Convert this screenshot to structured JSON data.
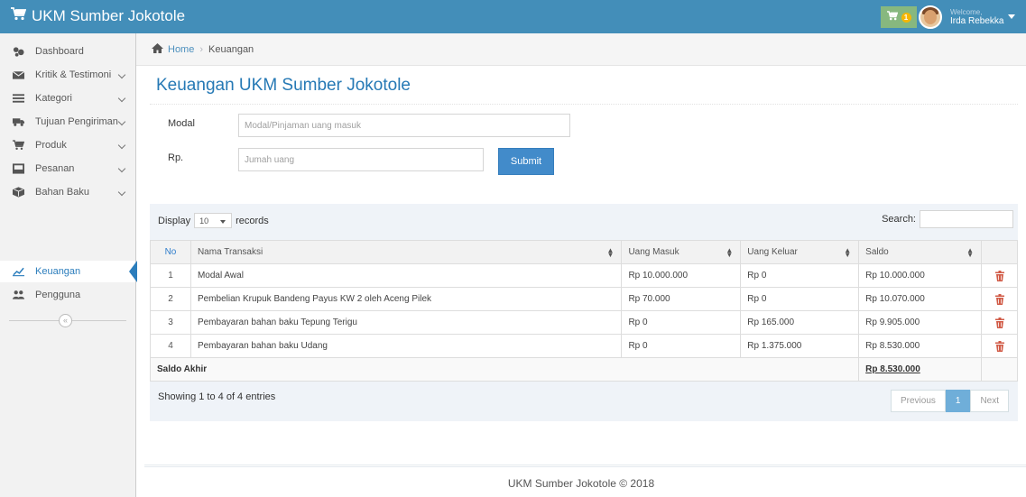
{
  "app": {
    "title": "UKM Sumber Jokotole",
    "cart_count": "1"
  },
  "user": {
    "welcome": "Welcome,",
    "name": "Irda Rebekka"
  },
  "sidebar": {
    "items": [
      {
        "label": "Dashboard",
        "icon": "tachometer-icon"
      },
      {
        "label": "Kritik & Testimoni",
        "icon": "envelope-icon"
      },
      {
        "label": "Kategori",
        "icon": "list-icon"
      },
      {
        "label": "Tujuan Pengiriman",
        "icon": "truck-icon"
      },
      {
        "label": "Produk",
        "icon": "shopping-cart-icon"
      },
      {
        "label": "Pesanan",
        "icon": "inbox-icon"
      },
      {
        "label": "Bahan Baku",
        "icon": "cube-icon"
      },
      {
        "label": "Keuangan",
        "icon": "line-chart-icon"
      },
      {
        "label": "Pengguna",
        "icon": "users-icon"
      }
    ],
    "collapse_glyph": "«"
  },
  "breadcrumb": {
    "home": "Home",
    "separator": "›",
    "current": "Keuangan"
  },
  "page": {
    "title": "Keuangan UKM Sumber Jokotole"
  },
  "form": {
    "modal_label": "Modal",
    "modal_placeholder": "Modal/Pinjaman uang masuk",
    "rp_label": "Rp.",
    "rp_placeholder": "Jumah uang",
    "submit_label": "Submit"
  },
  "table": {
    "display_label": "Display",
    "page_size": "10",
    "records_label": "records",
    "search_label": "Search:",
    "headers": [
      "No",
      "Nama Transaksi",
      "Uang Masuk",
      "Uang Keluar",
      "Saldo"
    ],
    "rows": [
      {
        "no": "1",
        "nama": "Modal Awal",
        "masuk": "Rp 10.000.000",
        "keluar": "Rp 0",
        "saldo": "Rp 10.000.000"
      },
      {
        "no": "2",
        "nama": "Pembelian Krupuk Bandeng Payus KW 2 oleh Aceng Pilek",
        "masuk": "Rp 70.000",
        "keluar": "Rp 0",
        "saldo": "Rp 10.070.000"
      },
      {
        "no": "3",
        "nama": "Pembayaran bahan baku Tepung Terigu",
        "masuk": "Rp 0",
        "keluar": "Rp 165.000",
        "saldo": "Rp 9.905.000"
      },
      {
        "no": "4",
        "nama": "Pembayaran bahan baku Udang",
        "masuk": "Rp 0",
        "keluar": "Rp 1.375.000",
        "saldo": "Rp 8.530.000"
      }
    ],
    "footer_label": "Saldo Akhir",
    "footer_total": "Rp 8.530.000",
    "info": "Showing 1 to 4 of 4 entries",
    "pager": {
      "previous": "Previous",
      "current": "1",
      "next": "Next"
    }
  },
  "footer": {
    "text": "UKM Sumber Jokotole © 2018"
  },
  "colors": {
    "navbar": "#438eb9",
    "accent": "#2b7dbc",
    "cart": "#87b87f",
    "badge": "#f6b602",
    "trash": "#d15b47"
  }
}
